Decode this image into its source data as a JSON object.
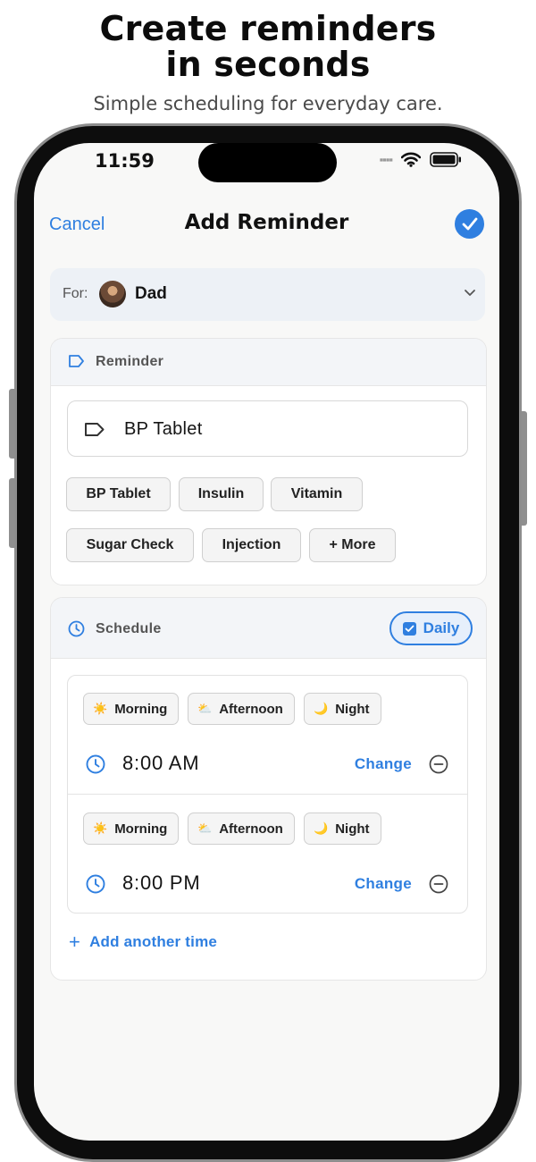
{
  "marketing": {
    "headline_line1": "Create reminders",
    "headline_line2": "in seconds",
    "subheadline": "Simple scheduling for everyday care."
  },
  "status_bar": {
    "time": "11:59"
  },
  "nav": {
    "cancel_label": "Cancel",
    "title": "Add Reminder"
  },
  "for_selector": {
    "label": "For:",
    "name": "Dad"
  },
  "reminder_card": {
    "title": "Reminder",
    "input_value": "BP Tablet",
    "chips": [
      "BP Tablet",
      "Insulin",
      "Vitamin",
      "Sugar Check",
      "Injection",
      "+ More"
    ]
  },
  "schedule_card": {
    "title": "Schedule",
    "daily_label": "Daily",
    "daily_checked": true,
    "times": [
      {
        "periods": [
          {
            "emoji": "☀️",
            "label": "Morning"
          },
          {
            "emoji": "⛅",
            "label": "Afternoon"
          },
          {
            "emoji": "🌙",
            "label": "Night"
          }
        ],
        "time": "8:00 AM",
        "change_label": "Change"
      },
      {
        "periods": [
          {
            "emoji": "☀️",
            "label": "Morning"
          },
          {
            "emoji": "⛅",
            "label": "Afternoon"
          },
          {
            "emoji": "🌙",
            "label": "Night"
          }
        ],
        "time": "8:00 PM",
        "change_label": "Change"
      }
    ],
    "add_time_label": "Add another time"
  },
  "colors": {
    "accent": "#2f7fe0",
    "screen_bg": "#f8f8f7",
    "header_bg": "#f3f5f8"
  }
}
